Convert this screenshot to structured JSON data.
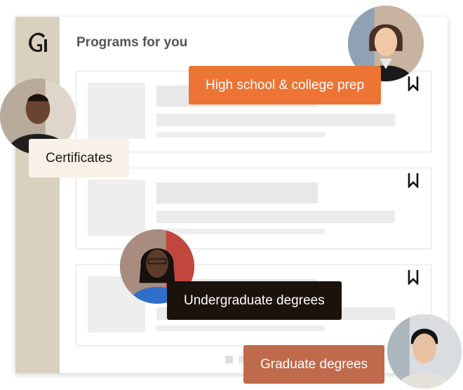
{
  "app": {
    "logo_letter": "G"
  },
  "main": {
    "heading": "Programs for you"
  },
  "cards": [
    {
      "bookmark_icon": "bookmark-icon"
    },
    {
      "bookmark_icon": "bookmark-icon"
    },
    {
      "bookmark_icon": "bookmark-icon"
    }
  ],
  "tags": {
    "high_school": "High school & college prep",
    "certificates": "Certificates",
    "undergraduate": "Undergraduate degrees",
    "graduate": "Graduate degrees"
  },
  "colors": {
    "sidebar": "#d7d1bd",
    "high_school_tag": "#ec7434",
    "certificates_tag": "#f8f1e7",
    "undergraduate_tag": "#1b120c",
    "graduate_tag": "#c06a4c"
  }
}
